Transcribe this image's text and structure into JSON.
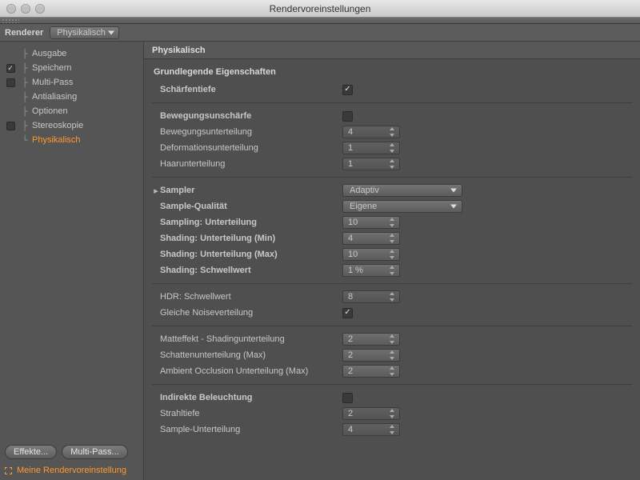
{
  "window": {
    "title": "Rendervoreinstellungen"
  },
  "rendererBar": {
    "label": "Renderer",
    "value": "Physikalisch"
  },
  "tree": {
    "items": [
      {
        "label": "Ausgabe",
        "checkbox": false,
        "checked": false
      },
      {
        "label": "Speichern",
        "checkbox": true,
        "checked": true
      },
      {
        "label": "Multi-Pass",
        "checkbox": true,
        "checked": false
      },
      {
        "label": "Antialiasing",
        "checkbox": false,
        "checked": false
      },
      {
        "label": "Optionen",
        "checkbox": false,
        "checked": false
      },
      {
        "label": "Stereoskopie",
        "checkbox": true,
        "checked": false
      },
      {
        "label": "Physikalisch",
        "checkbox": false,
        "checked": false
      }
    ]
  },
  "sidebar": {
    "effekte": "Effekte...",
    "multipass": "Multi-Pass...",
    "presetLabel": "Meine Rendervoreinstellung"
  },
  "panel": {
    "tab": "Physikalisch",
    "groupTitle": "Grundlegende Eigenschaften",
    "rows": {
      "schaerfentiefe": {
        "label": "Schärfentiefe",
        "checked": true
      },
      "bewUnschaerfe": {
        "label": "Bewegungsunschärfe",
        "checked": false
      },
      "bewUnterteilung": {
        "label": "Bewegungsunterteilung",
        "value": "4"
      },
      "defUnterteilung": {
        "label": "Deformationsunterteilung",
        "value": "1"
      },
      "haarUnterteilung": {
        "label": "Haarunterteilung",
        "value": "1"
      },
      "sampler": {
        "label": "Sampler",
        "value": "Adaptiv"
      },
      "sampleQualitaet": {
        "label": "Sample-Qualität",
        "value": "Eigene"
      },
      "samplingUnt": {
        "label": "Sampling: Unterteilung",
        "value": "10"
      },
      "shadingMin": {
        "label": "Shading: Unterteilung (Min)",
        "value": "4"
      },
      "shadingMax": {
        "label": "Shading: Unterteilung (Max)",
        "value": "10"
      },
      "shadingSchwell": {
        "label": "Shading: Schwellwert",
        "value": "1 %"
      },
      "hdrSchwell": {
        "label": "HDR: Schwellwert",
        "value": "8"
      },
      "gleicheNoise": {
        "label": "Gleiche Noiseverteilung",
        "checked": true
      },
      "matteffekt": {
        "label": "Matteffekt - Shadingunterteilung",
        "value": "2"
      },
      "schattenMax": {
        "label": "Schattenunterteilung (Max)",
        "value": "2"
      },
      "aoMax": {
        "label": "Ambient Occlusion Unterteilung (Max)",
        "value": "2"
      },
      "indirekte": {
        "label": "Indirekte Beleuchtung",
        "checked": false
      },
      "strahltiefe": {
        "label": "Strahltiefe",
        "value": "2"
      },
      "sampleUnt": {
        "label": "Sample-Unterteilung",
        "value": "4"
      }
    }
  }
}
